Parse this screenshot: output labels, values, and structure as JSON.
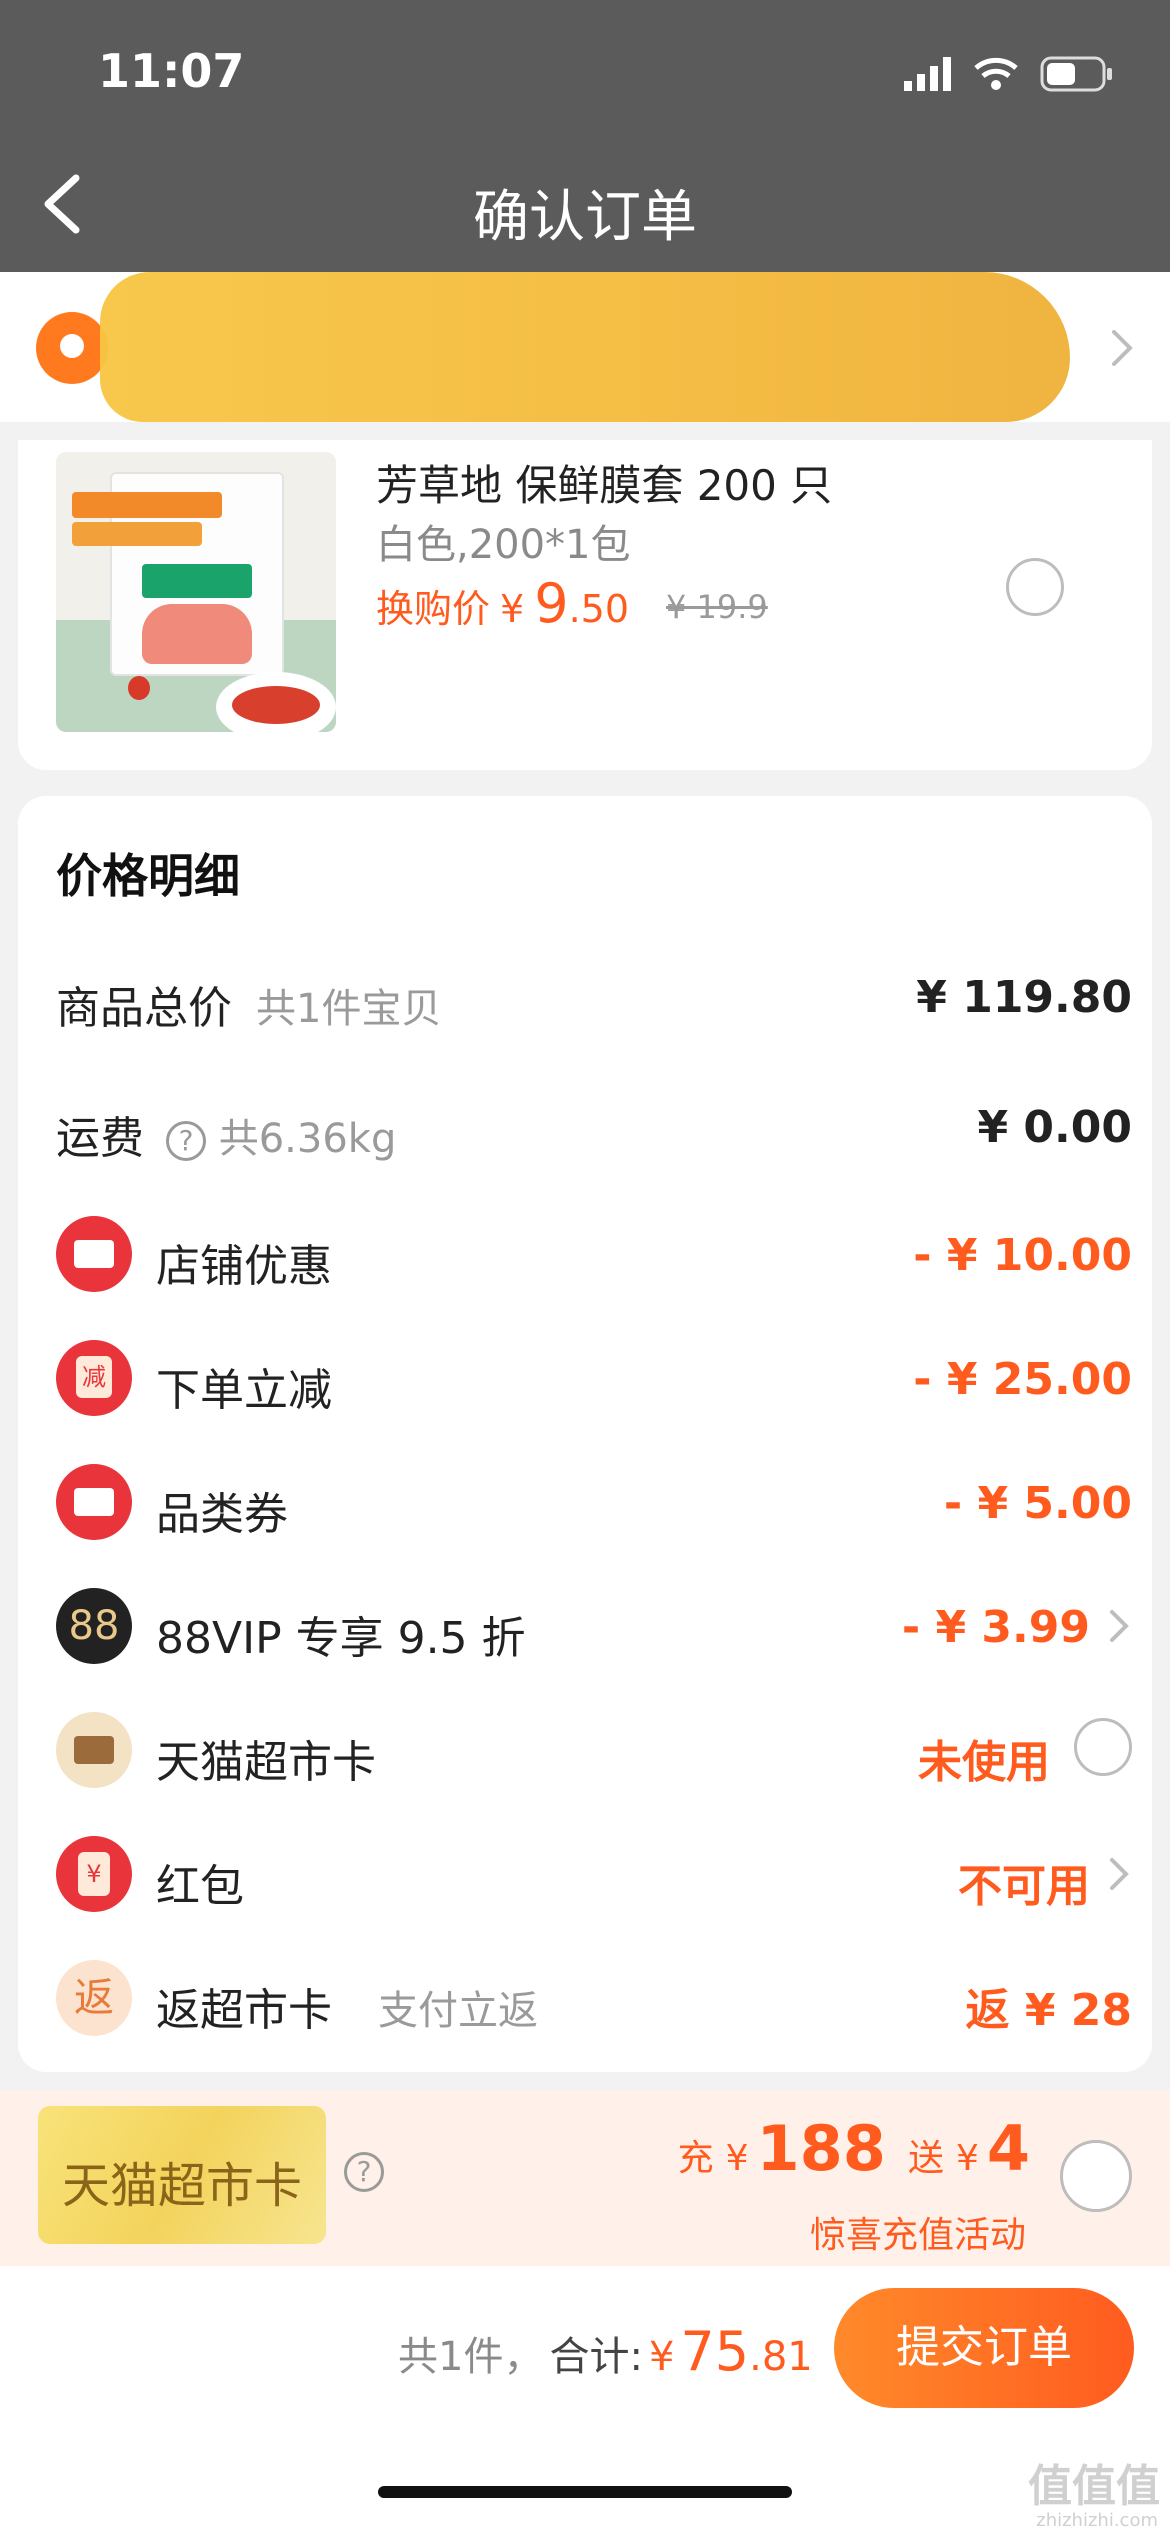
{
  "status": {
    "time": "11:07",
    "battery_icon": "battery-icon",
    "wifi_icon": "wifi-icon",
    "signal_icon": "signal-icon"
  },
  "nav": {
    "title": "确认订单",
    "back_icon": "back-arrow-icon"
  },
  "address": {
    "icon": "location-pin-icon"
  },
  "product": {
    "name": "芳草地 保鲜膜套 200 只",
    "spec": "白色,200*1包",
    "price_label": "换购价",
    "currency": "¥",
    "price_int": "9",
    "price_dec": ".50",
    "original_price": "¥ 19.9"
  },
  "detail": {
    "title": "价格明细",
    "goods_total": {
      "label": "商品总价",
      "sub": "共1件宝贝",
      "value": "¥ 119.80"
    },
    "shipping": {
      "label": "运费",
      "sub": "共6.36kg",
      "value": "¥ 0.00"
    },
    "shop_discount": {
      "label": "店铺优惠",
      "value": "- ¥ 10.00"
    },
    "order_cut": {
      "label": "下单立减",
      "value": "- ¥ 25.00"
    },
    "category_coupon": {
      "label": "品类券",
      "value": "- ¥ 5.00"
    },
    "vip": {
      "label": "88VIP 专享 9.5 折",
      "icon_text": "88",
      "value": "- ¥ 3.99"
    },
    "tmall_card": {
      "label": "天猫超市卡",
      "value": "未使用"
    },
    "red_packet": {
      "label": "红包",
      "value": "不可用"
    },
    "rebate": {
      "label": "返超市卡",
      "icon_text": "返",
      "sub": "支付立返",
      "value": "返 ¥ 28"
    }
  },
  "promo": {
    "card_text": "天猫超市卡",
    "charge_prefix": "充",
    "currency": "¥",
    "charge_amount": "188",
    "gift_prefix": "送",
    "gift_amount": "4",
    "subtitle": "惊喜充值活动"
  },
  "footer": {
    "count_text": "共1件，",
    "total_label": "合计:",
    "currency": "¥",
    "total_int": "75",
    "total_dec": ".81",
    "submit_label": "提交订单"
  },
  "watermark": {
    "text": "值值值",
    "domain": "zhizhizhi.com"
  },
  "colors": {
    "accent": "#ff5b1f",
    "nav_bg": "#5b5b5b",
    "page_bg": "#f2f2f2"
  }
}
